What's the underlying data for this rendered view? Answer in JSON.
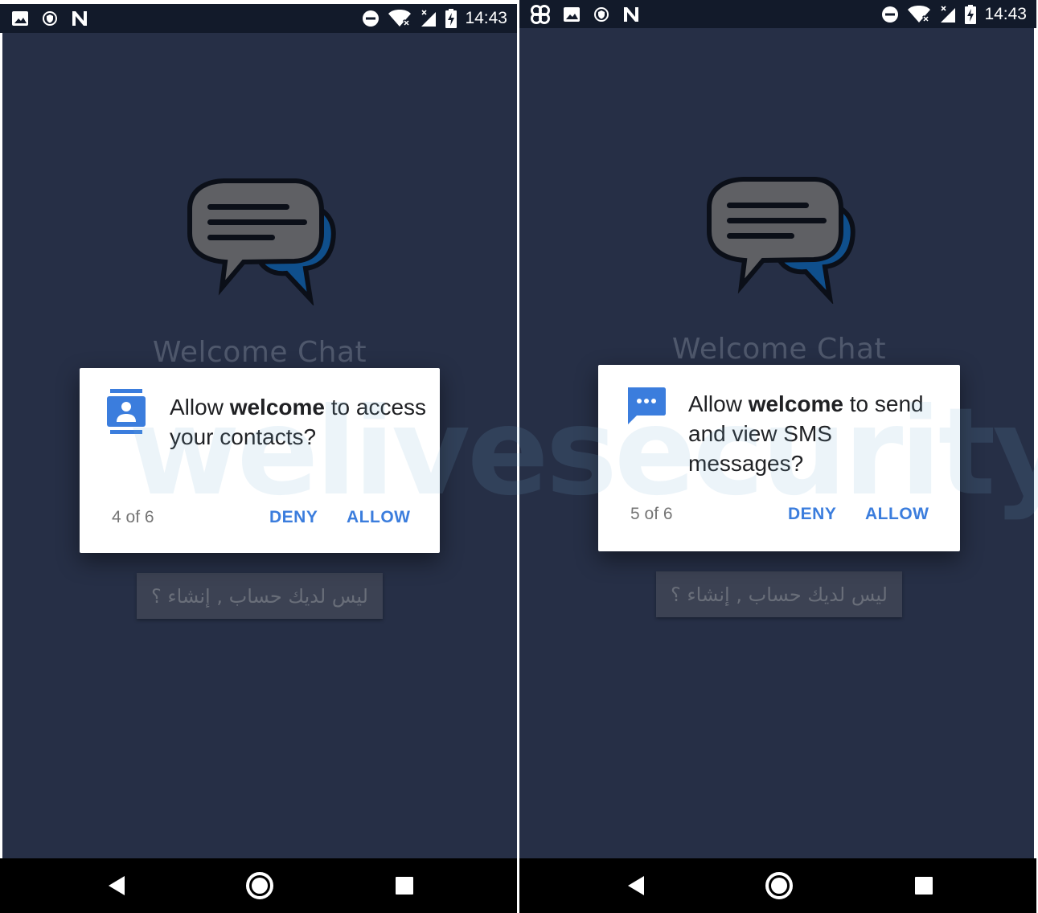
{
  "watermark": "welivesecurity",
  "screens": [
    {
      "status": {
        "time": "14:43"
      },
      "app_title": "Welcome Chat",
      "create_account_label": "ليس لديك حساب , إنشاء ؟",
      "dialog": {
        "icon": "contacts-icon",
        "prefix": "Allow ",
        "app_name": "welcome",
        "suffix": " to access your contacts?",
        "counter": "4 of 6",
        "deny_label": "DENY",
        "allow_label": "ALLOW"
      }
    },
    {
      "status": {
        "time": "14:43"
      },
      "app_title": "Welcome Chat",
      "create_account_label": "ليس لديك حساب , إنشاء ؟",
      "dialog": {
        "icon": "sms-icon",
        "prefix": "Allow ",
        "app_name": "welcome",
        "suffix": " to send and view SMS messages?",
        "counter": "5 of 6",
        "deny_label": "DENY",
        "allow_label": "ALLOW"
      }
    }
  ],
  "colors": {
    "accent": "#3b7ddd",
    "app_bg": "#262f46",
    "status_bar": "#121a2a",
    "logo_blue": "#0f4f8c"
  }
}
